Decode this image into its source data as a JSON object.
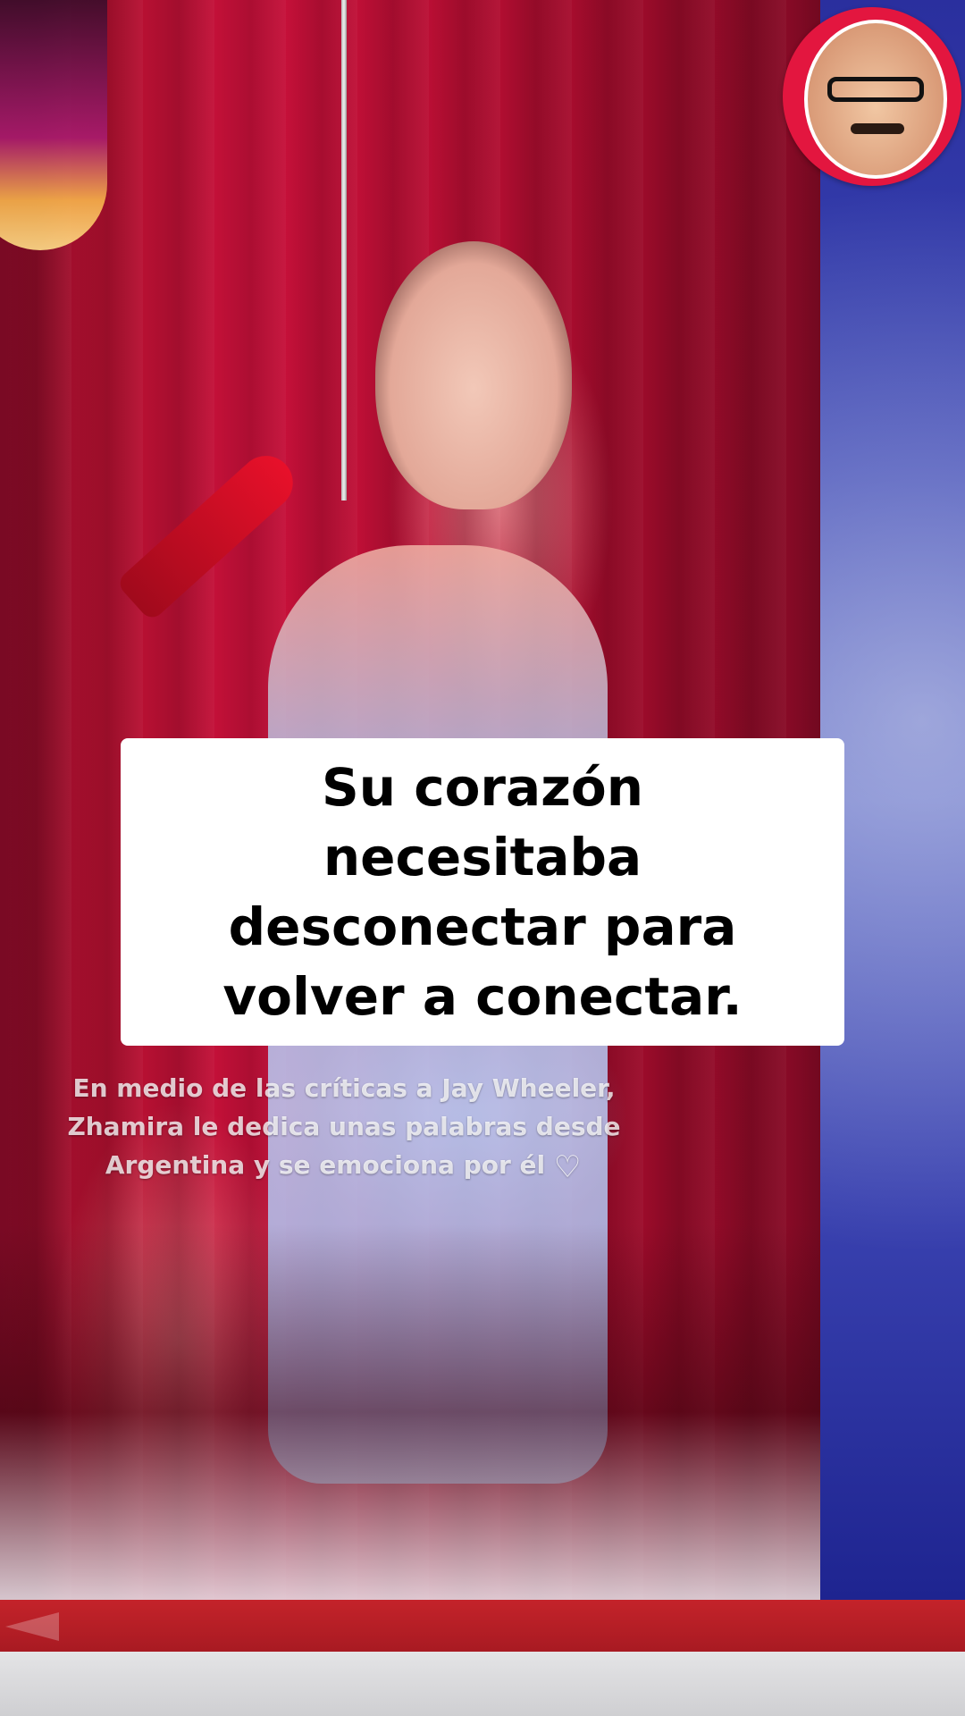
{
  "caption": {
    "text": "Su corazón\nnecesitaba\ndesconectar para\nvolver a conectar."
  },
  "video_overlay": {
    "text": "En medio de las críticas a Jay Wheeler,\nZhamira le dedica unas palabras desde\nArgentina y se emociona por él",
    "emoji": "♡"
  },
  "colors": {
    "caption_background": "#ffffff",
    "caption_text": "#000000",
    "avatar_ring": "#e3163f",
    "bottom_bar": "#c4232a",
    "side_panel": "#2a2f9e",
    "curtain": "#c8103a"
  },
  "icons": {
    "host_avatar": "host-avatar-icon",
    "back_arrow": "arrow-left-icon",
    "heart": "white-heart-icon"
  }
}
